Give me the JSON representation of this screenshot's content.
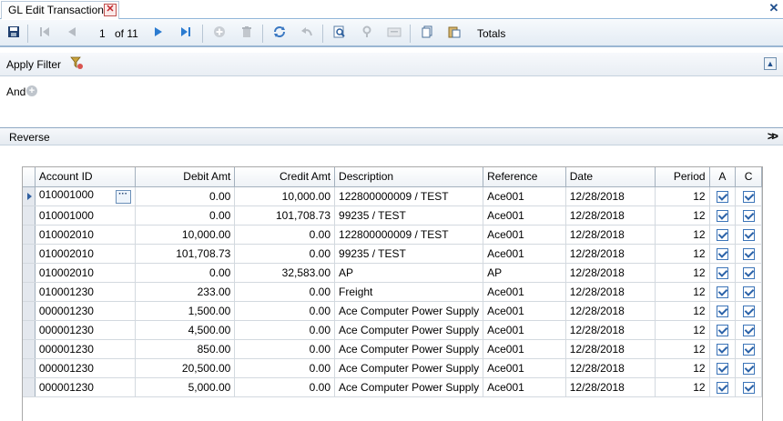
{
  "tab": {
    "title": "GL Edit Transactions"
  },
  "toolbar": {
    "page_current": "1",
    "page_of": "of 11",
    "totals_label": "Totals"
  },
  "filter": {
    "title": "Apply Filter",
    "and_label": "And"
  },
  "reverse": {
    "title": "Reverse"
  },
  "grid": {
    "columns": [
      "Account ID",
      "Debit Amt",
      "Credit Amt",
      "Description",
      "Reference",
      "Date",
      "Period",
      "A",
      "C"
    ],
    "rows": [
      [
        "010001000",
        "0.00",
        "10,000.00",
        "122800000009 / TEST",
        "Ace001",
        "12/28/2018",
        "12"
      ],
      [
        "010001000",
        "0.00",
        "101,708.73",
        "99235 / TEST",
        "Ace001",
        "12/28/2018",
        "12"
      ],
      [
        "010002010",
        "10,000.00",
        "0.00",
        "122800000009 / TEST",
        "Ace001",
        "12/28/2018",
        "12"
      ],
      [
        "010002010",
        "101,708.73",
        "0.00",
        "99235 / TEST",
        "Ace001",
        "12/28/2018",
        "12"
      ],
      [
        "010002010",
        "0.00",
        "32,583.00",
        "AP",
        "AP",
        "12/28/2018",
        "12"
      ],
      [
        "010001230",
        "233.00",
        "0.00",
        "Freight",
        "Ace001",
        "12/28/2018",
        "12"
      ],
      [
        "000001230",
        "1,500.00",
        "0.00",
        "Ace Computer Power Supply",
        "Ace001",
        "12/28/2018",
        "12"
      ],
      [
        "000001230",
        "4,500.00",
        "0.00",
        "Ace Computer Power Supply",
        "Ace001",
        "12/28/2018",
        "12"
      ],
      [
        "000001230",
        "850.00",
        "0.00",
        "Ace Computer Power Supply",
        "Ace001",
        "12/28/2018",
        "12"
      ],
      [
        "000001230",
        "20,500.00",
        "0.00",
        "Ace Computer Power Supply",
        "Ace001",
        "12/28/2018",
        "12"
      ],
      [
        "000001230",
        "5,000.00",
        "0.00",
        "Ace Computer Power Supply",
        "Ace001",
        "12/28/2018",
        "12"
      ]
    ]
  }
}
